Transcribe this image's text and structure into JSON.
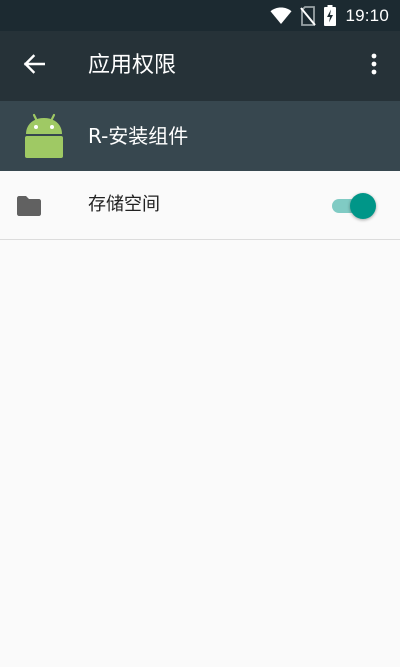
{
  "status_bar": {
    "time": "19:10",
    "icons": [
      "wifi-icon",
      "no-sim-icon",
      "battery-charging-icon"
    ]
  },
  "app_bar": {
    "title": "应用权限",
    "back_icon": "arrow-back-icon",
    "menu_icon": "more-vert-icon"
  },
  "app_header": {
    "app_name": "R-安装组件",
    "icon": "android-icon"
  },
  "permissions": [
    {
      "label": "存储空间",
      "icon": "folder-icon",
      "enabled": true
    }
  ],
  "colors": {
    "status_bar": "#1c2a31",
    "app_bar": "#263238",
    "app_header": "#37474f",
    "android_green": "#9fc964",
    "toggle_accent": "#009688",
    "toggle_track": "#80cbc4",
    "background": "#fafafa"
  }
}
